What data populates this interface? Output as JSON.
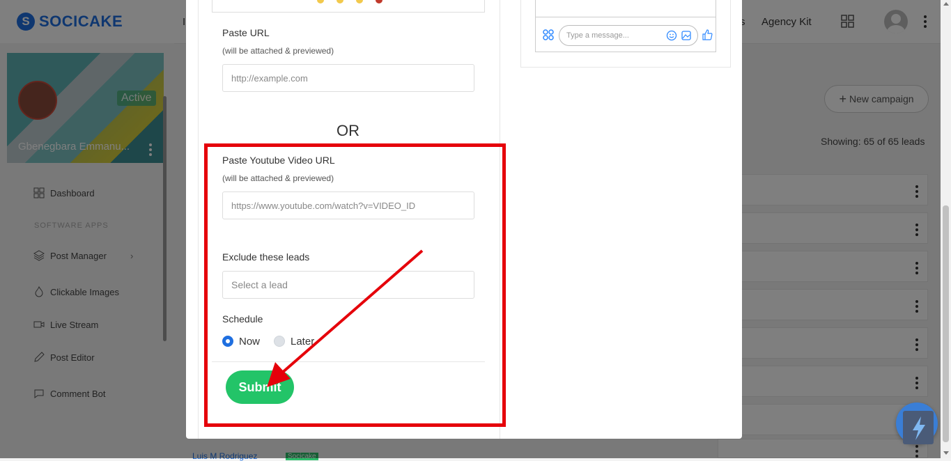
{
  "app": {
    "logo_text": "SOCICAKE"
  },
  "topbar": {
    "agency_kit": "Agency Kit",
    "fragment_left": "I",
    "fragment_right": "s"
  },
  "sidebar": {
    "profile_name": "Gbenegbara Emmanu...",
    "status_badge": "Active",
    "section_label": "SOFTWARE APPS",
    "items": [
      {
        "label": "Dashboard",
        "icon": "dashboard-icon"
      },
      {
        "label": "Post Manager",
        "icon": "layers-icon"
      },
      {
        "label": "Clickable Images",
        "icon": "flame-icon"
      },
      {
        "label": "Live Stream",
        "icon": "video-icon"
      },
      {
        "label": "Post Editor",
        "icon": "pencil-icon"
      },
      {
        "label": "Comment Bot",
        "icon": "chat-icon"
      }
    ]
  },
  "main": {
    "new_campaign": "New campaign",
    "showing": "Showing: 65 of 65 leads",
    "bottom_row_name": "Luis M Rodriguez",
    "bottom_row_tag": "Socicake"
  },
  "modal": {
    "paste_url": {
      "label": "Paste URL",
      "sublabel": "(will be attached & previewed)",
      "placeholder": "http://example.com"
    },
    "or_text": "OR",
    "youtube": {
      "label": "Paste Youtube Video URL",
      "sublabel": "(will be attached & previewed)",
      "placeholder": "https://www.youtube.com/watch?v=VIDEO_ID"
    },
    "exclude": {
      "label": "Exclude these leads",
      "placeholder": "Select a lead"
    },
    "schedule": {
      "label": "Schedule",
      "option_now": "Now",
      "option_later": "Later",
      "selected": "Now"
    },
    "submit_label": "Submit",
    "preview": {
      "message_placeholder": "Type a message..."
    }
  },
  "colors": {
    "brand_blue": "#1f6fe0",
    "submit_green": "#23c468",
    "highlight_red": "#e5000a"
  }
}
